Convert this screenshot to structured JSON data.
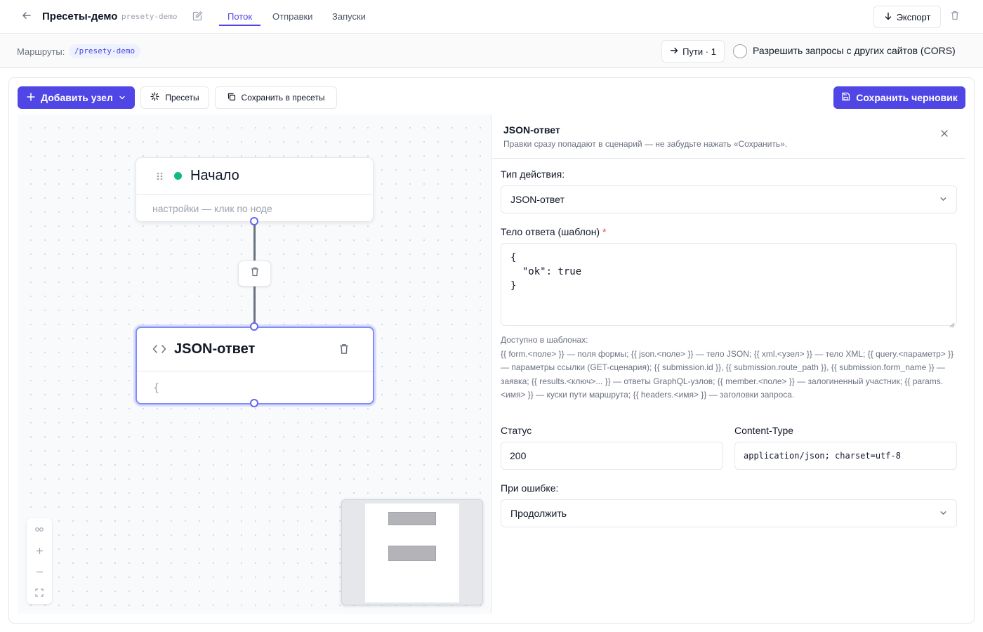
{
  "header": {
    "back_icon": "arrow-left-icon",
    "title": "Пресеты-демо",
    "slug": "presety-demo",
    "edit_icon": "pencil-icon",
    "tabs": [
      {
        "label": "Поток",
        "active": true
      },
      {
        "label": "Отправки",
        "active": false
      },
      {
        "label": "Запуски",
        "active": false
      }
    ],
    "export_label": "Экспорт",
    "export_icon": "arrow-down-icon",
    "delete_icon": "trash-icon"
  },
  "routes": {
    "label": "Маршруты:",
    "chip": "/presety-demo",
    "paths_label": "Пути · 1",
    "paths_icon": "arrow-right-icon",
    "cors_label": "Разрешить запросы с других сайтов (CORS)",
    "cors_checked": false
  },
  "toolbar": {
    "add_node_label": "Добавить узел",
    "presets_label": "Пресеты",
    "save_to_presets_label": "Сохранить в пресеты",
    "save_draft_label": "Сохранить черновик"
  },
  "canvas": {
    "start_node": {
      "title": "Начало",
      "subtitle": "настройки — клик по ноде",
      "status_color": "#10b981"
    },
    "json_node": {
      "title": "JSON-ответ",
      "preview": "{"
    },
    "zoom_controls": [
      "link-icon",
      "zoom-in-icon",
      "zoom-out-icon",
      "fit-view-icon"
    ]
  },
  "side_panel": {
    "title": "JSON-ответ",
    "hint": "Правки сразу попадают в сценарий — не забудьте нажать «Сохранить».",
    "action_type_label": "Тип действия:",
    "action_type_value": "JSON-ответ",
    "body_label": "Тело ответа (шаблон)",
    "body_required_mark": "*",
    "body_value": "{\n  \"ok\": true\n}",
    "help_title": "Доступно в шаблонах:",
    "help_text": "{{ form.<поле> }} — поля формы; {{ json.<поле> }} — тело JSON; {{ xml.<узел> }} — тело XML; {{ query.<параметр> }} — параметры ссылки (GET-сценария); {{ submission.id }}, {{ submission.route_path }}, {{ submission.form_name }} — заявка; {{ results.<ключ>... }} — ответы GraphQL-узлов; {{ member.<поле> }} — залогиненный участник; {{ params.<имя> }} — куски пути маршрута; {{ headers.<имя> }} — заголовки запроса.",
    "status_label": "Статус",
    "status_value": "200",
    "content_type_label": "Content-Type",
    "content_type_value": "application/json; charset=utf-8",
    "on_error_label": "При ошибке:",
    "on_error_value": "Продолжить"
  },
  "colors": {
    "accent": "#4f46e5",
    "success": "#10b981",
    "required": "#ef4444"
  }
}
